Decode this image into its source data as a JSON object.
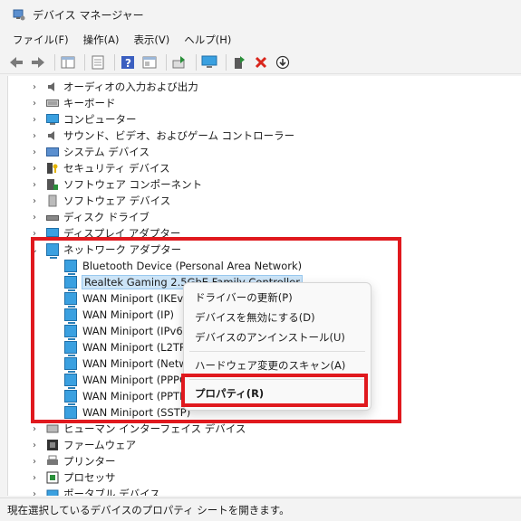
{
  "window": {
    "title": "デバイス マネージャー"
  },
  "menu": [
    "ファイル(F)",
    "操作(A)",
    "表示(V)",
    "ヘルプ(H)"
  ],
  "tree": {
    "categories_top": [
      {
        "label": "オーディオの入力および出力",
        "icon": "speaker-icon"
      },
      {
        "label": "キーボード",
        "icon": "keyboard-icon"
      },
      {
        "label": "コンピューター",
        "icon": "computer-icon"
      },
      {
        "label": "サウンド、ビデオ、およびゲーム コントローラー",
        "icon": "speaker-icon"
      },
      {
        "label": "システム デバイス",
        "icon": "system-icon"
      },
      {
        "label": "セキュリティ デバイス",
        "icon": "key-icon"
      },
      {
        "label": "ソフトウェア コンポーネント",
        "icon": "component-icon"
      },
      {
        "label": "ソフトウェア デバイス",
        "icon": "device-icon"
      },
      {
        "label": "ディスク ドライブ",
        "icon": "disk-icon"
      },
      {
        "label": "ディスプレイ アダプター",
        "icon": "display-icon"
      }
    ],
    "network": {
      "label": "ネットワーク アダプター",
      "children": [
        "Bluetooth Device (Personal Area Network)",
        "Realtek Gaming 2.5GbE Family Controller",
        "WAN Miniport (IKEv2)",
        "WAN Miniport (IP)",
        "WAN Miniport (IPv6)",
        "WAN Miniport (L2TP)",
        "WAN Miniport (Network Monitor)",
        "WAN Miniport (PPPOE)",
        "WAN Miniport (PPTP)",
        "WAN Miniport (SSTP)"
      ]
    },
    "categories_bottom": [
      {
        "label": "ヒューマン インターフェイス デバイス",
        "icon": "hid-icon"
      },
      {
        "label": "ファームウェア",
        "icon": "firmware-icon"
      },
      {
        "label": "プリンター",
        "icon": "printer-icon"
      },
      {
        "label": "プロセッサ",
        "icon": "processor-icon"
      },
      {
        "label": "ポータブル デバイス",
        "icon": "portable-icon"
      }
    ]
  },
  "context_menu": {
    "update_driver": "ドライバーの更新(P)",
    "disable": "デバイスを無効にする(D)",
    "uninstall": "デバイスのアンインストール(U)",
    "scan": "ハードウェア変更のスキャン(A)",
    "properties": "プロパティ(R)"
  },
  "status": "現在選択しているデバイスのプロパティ シートを開きます。",
  "colors": {
    "highlight": "#e0191e",
    "selection": "#cce4f7"
  }
}
